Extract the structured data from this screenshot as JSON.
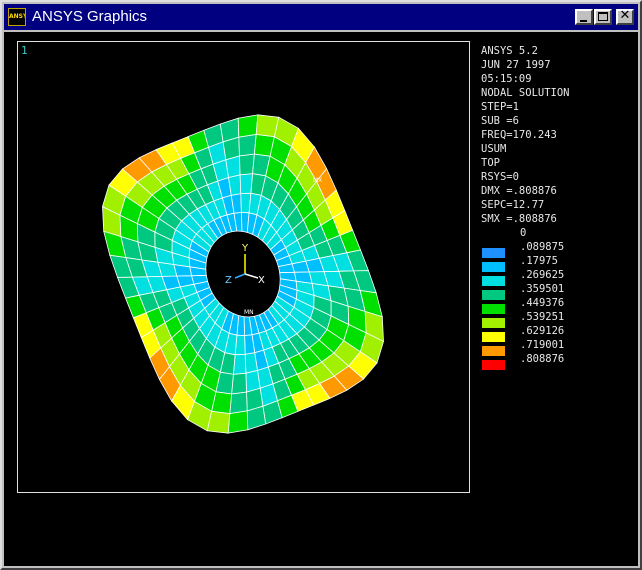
{
  "window": {
    "title": "ANSYS Graphics",
    "icon_text": "ANSYS"
  },
  "viewport": {
    "window_number": "1"
  },
  "info_lines": [
    "ANSYS 5.2",
    "JUN 27 1997",
    "05:15:09",
    "NODAL SOLUTION",
    "STEP=1",
    "SUB =6",
    "FREQ=170.243",
    "USUM",
    "TOP",
    "RSYS=0",
    "DMX =.808876",
    "SEPC=12.77",
    "SMX =.808876"
  ],
  "legend": [
    {
      "label": "0",
      "color": "#0000ff"
    },
    {
      "label": ".089875",
      "color": "#1e90ff"
    },
    {
      "label": ".17975",
      "color": "#00bfff"
    },
    {
      "label": ".269625",
      "color": "#00e0e0"
    },
    {
      "label": ".359501",
      "color": "#00c880"
    },
    {
      "label": ".449376",
      "color": "#00e000"
    },
    {
      "label": ".539251",
      "color": "#a0f000"
    },
    {
      "label": ".629126",
      "color": "#ffff00"
    },
    {
      "label": ".719001",
      "color": "#ff9900"
    },
    {
      "label": ".808876",
      "color": "#ff0000"
    }
  ],
  "triad": {
    "x": "X",
    "y": "Y",
    "z": "Z"
  },
  "node_labels": {
    "mx": "MX",
    "mn": "MN"
  },
  "colors": {
    "titlebar": "#000080",
    "background": "#000000",
    "mesh": "#ffffff"
  }
}
